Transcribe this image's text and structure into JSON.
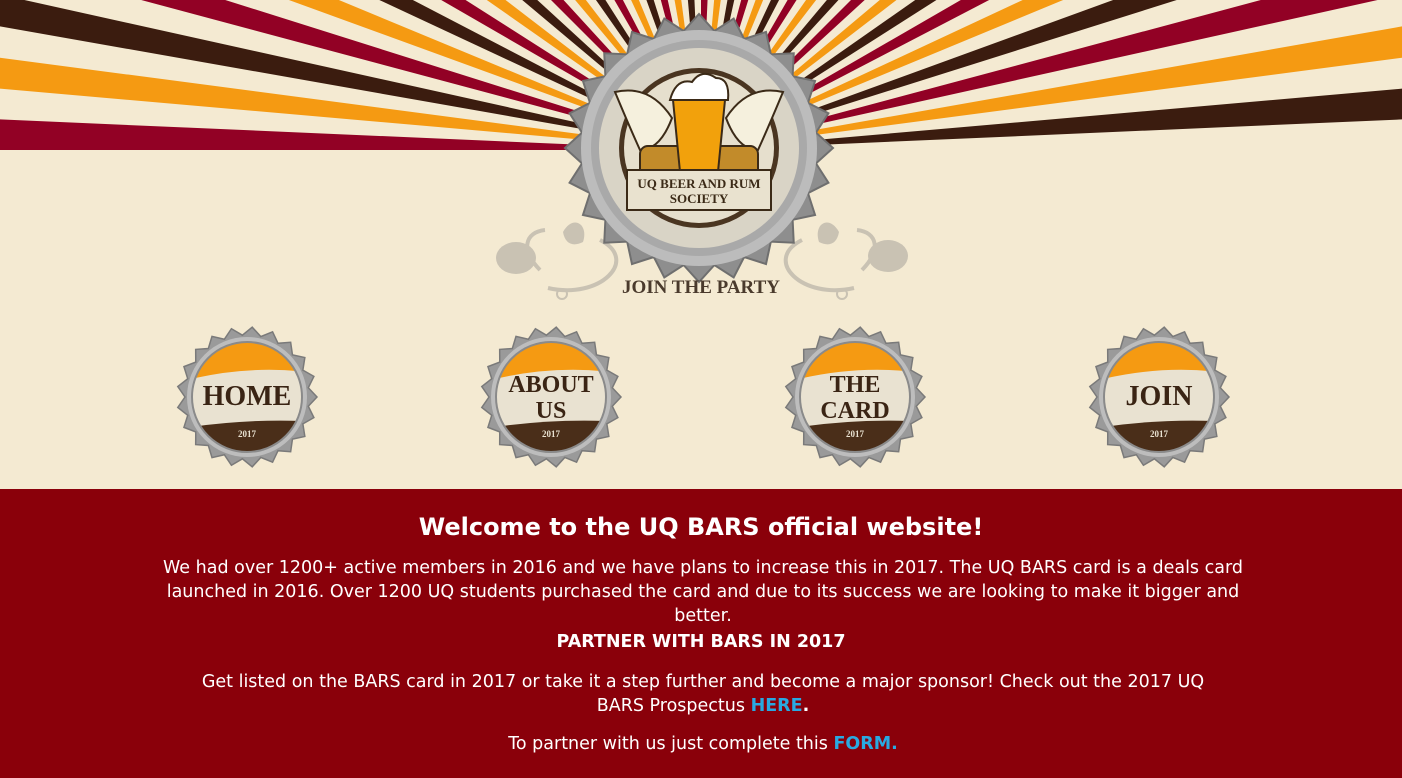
{
  "header": {
    "logo": {
      "title_line1": "UQ BEER AND RUM",
      "title_line2": "SOCIETY",
      "slogan": "JOIN THE PARTY"
    },
    "sunburst_colors": [
      "#920125",
      "#f59a12",
      "#3b1c0f"
    ]
  },
  "nav": {
    "items": [
      {
        "line1": "HOME",
        "line2": "",
        "year": "2017",
        "icon": "home-bottle-cap-icon"
      },
      {
        "line1": "ABOUT",
        "line2": "US",
        "year": "2017",
        "icon": "about-bottle-cap-icon"
      },
      {
        "line1": "THE",
        "line2": "CARD",
        "year": "2017",
        "icon": "card-bottle-cap-icon"
      },
      {
        "line1": "JOIN",
        "line2": "",
        "year": "2017",
        "icon": "join-bottle-cap-icon"
      }
    ]
  },
  "content": {
    "welcome_title": "Welcome to the UQ BARS official website!",
    "intro": "We had over 1200+ active members in 2016 and we have plans to increase this in 2017. The UQ BARS card is a deals card launched in 2016. Over 1200 UQ students purchased the card and due to its success we are looking to make it bigger and better.",
    "partner_heading": "PARTNER WITH BARS IN 2017",
    "prospectus_text": "Get listed on the BARS card in 2017 or take it a step further and become a major sponsor! Check out the 2017 UQ BARS Prospectus ",
    "prospectus_link": "HERE",
    "prospectus_end": ".",
    "form_text": "To partner with us just complete this ",
    "form_link": "FORM."
  },
  "colors": {
    "cream": "#f4ead2",
    "crimson": "#8a000a",
    "link": "#29a9e1",
    "orange": "#f59a12",
    "brown": "#3b1c0f"
  }
}
